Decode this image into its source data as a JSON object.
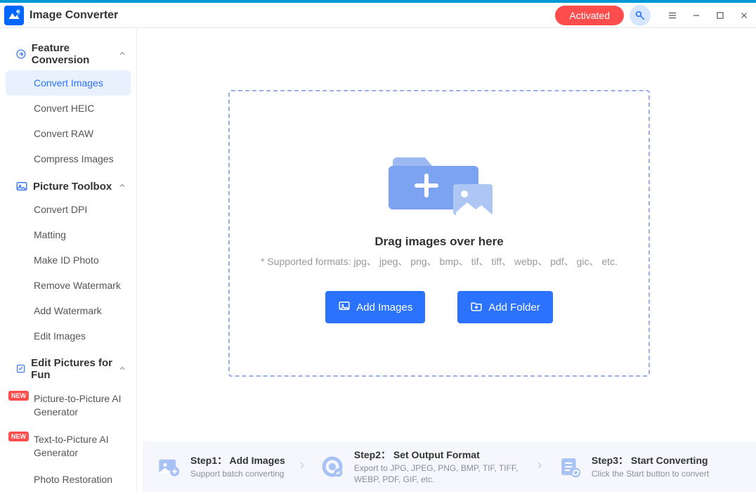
{
  "app": {
    "title": "Image Converter",
    "activated_label": "Activated"
  },
  "sidebar": {
    "groups": [
      {
        "label": "Feature Conversion",
        "items": [
          {
            "label": "Convert Images",
            "active": true
          },
          {
            "label": "Convert HEIC"
          },
          {
            "label": "Convert RAW"
          },
          {
            "label": "Compress Images"
          }
        ]
      },
      {
        "label": "Picture Toolbox",
        "items": [
          {
            "label": "Convert DPI"
          },
          {
            "label": "Matting"
          },
          {
            "label": "Make ID Photo"
          },
          {
            "label": "Remove Watermark"
          },
          {
            "label": "Add Watermark"
          },
          {
            "label": "Edit Images"
          }
        ]
      },
      {
        "label": "Edit Pictures for Fun",
        "items": [
          {
            "label": "Picture-to-Picture AI Generator",
            "badge": "NEW"
          },
          {
            "label": "Text-to-Picture AI Generator",
            "badge": "NEW"
          },
          {
            "label": "Photo Restoration"
          }
        ]
      }
    ]
  },
  "dropzone": {
    "title": "Drag images over here",
    "sub": "* Supported formats: jpg、 jpeg、 png、 bmp、 tif、 tiff、 webp、 pdf、 gic、 etc.",
    "add_images_label": "Add Images",
    "add_folder_label": "Add Folder"
  },
  "steps": {
    "s1_title": "Step1： Add Images",
    "s1_sub": "Support batch converting",
    "s2_title": "Step2： Set Output Format",
    "s2_sub": "Export to JPG, JPEG, PNG, BMP, TIF, TIFF, WEBP, PDF, GIF, etc.",
    "s3_title": "Step3： Start Converting",
    "s3_sub": "Click the Start button to convert"
  },
  "colors": {
    "accent": "#2b73ff",
    "activated": "#ff4d4d",
    "dashed_border": "#9aaee8"
  }
}
